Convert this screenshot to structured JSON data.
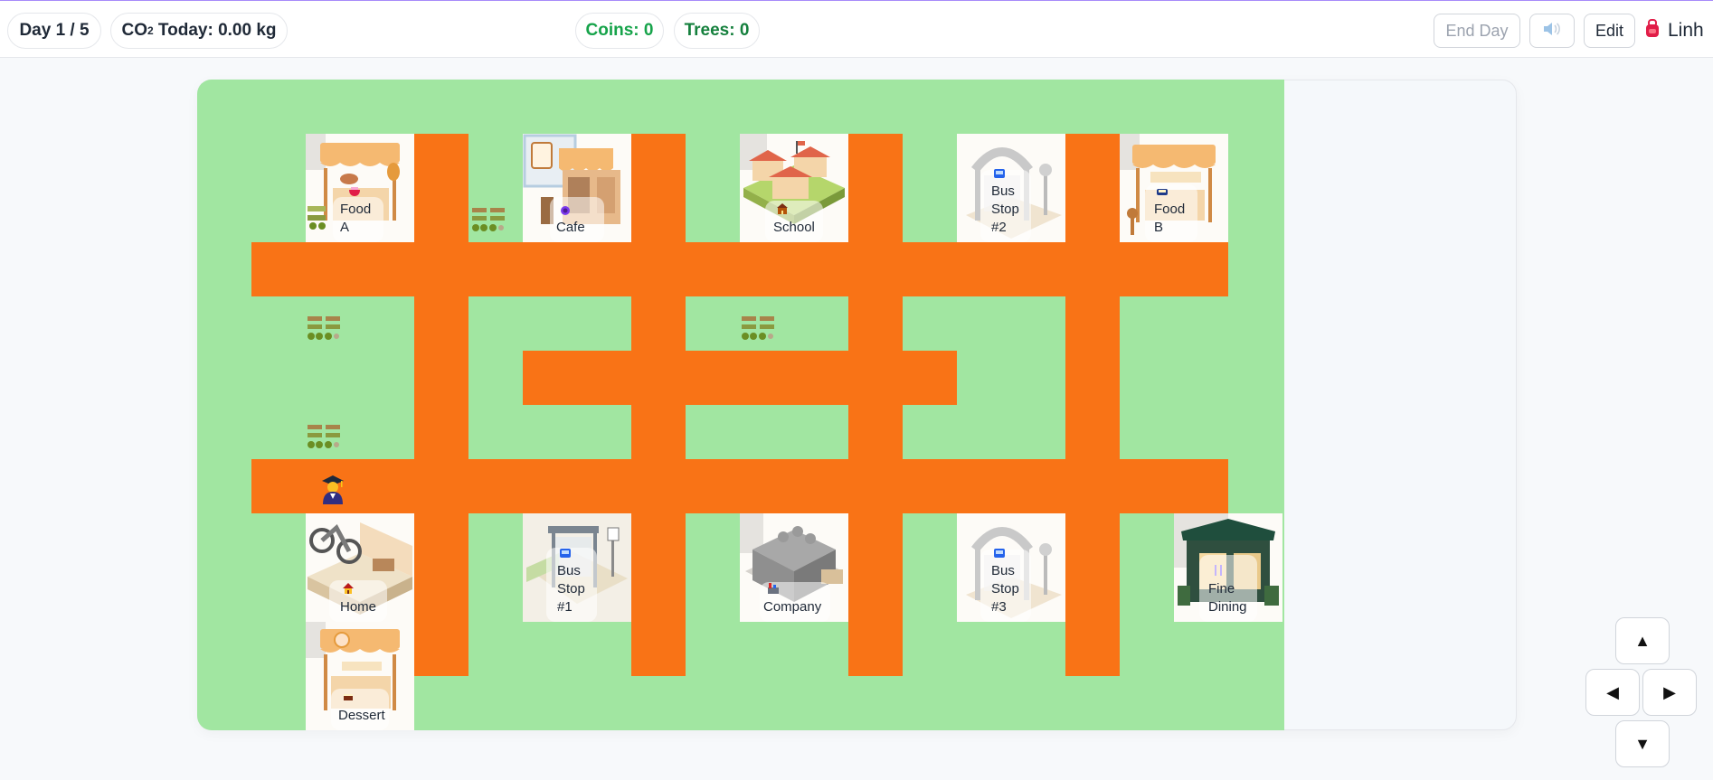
{
  "topbar": {
    "day": "Day 1 / 5",
    "co2_prefix": "CO",
    "co2_sub": "2",
    "co2_rest": " Today: 0.00 kg",
    "coins": "Coins: 0",
    "trees": "Trees: 0",
    "end_day": "End Day",
    "sound_icon": "speaker-icon",
    "edit": "Edit",
    "user_icon": "avatar-icon",
    "user_name": "Linh"
  },
  "colors": {
    "grass": "#a1e6a1",
    "road": "#f97316",
    "coins": "#16a34a",
    "trees": "#15803d"
  },
  "places": {
    "food_a": {
      "l1": "Food",
      "l2": "A",
      "icon": "bowl-icon"
    },
    "cafe": {
      "l1": "Cafe",
      "icon": "coffee-icon"
    },
    "school": {
      "l1": "School",
      "icon": "school-icon"
    },
    "bus2": {
      "l1": "Bus",
      "l2": "Stop",
      "l3": "#2",
      "icon": "bus-icon"
    },
    "food_b": {
      "l1": "Food",
      "l2": "B",
      "icon": "bento-icon"
    },
    "home": {
      "l1": "Home",
      "icon": "house-icon"
    },
    "bus1": {
      "l1": "Bus",
      "l2": "Stop",
      "l3": "#1",
      "icon": "bus-icon"
    },
    "company": {
      "l1": "Company",
      "icon": "factory-icon"
    },
    "bus3": {
      "l1": "Bus",
      "l2": "Stop",
      "l3": "#3",
      "icon": "bus-icon"
    },
    "fine": {
      "l1": "Fine",
      "l2": "Dining",
      "icon": "cutlery-icon"
    },
    "dessert": {
      "l1": "Dessert",
      "icon": "cake-icon"
    }
  },
  "player": {
    "icon": "student-icon"
  },
  "controls": {
    "up": "▲",
    "left": "◀",
    "right": "▶",
    "down": "▼"
  }
}
